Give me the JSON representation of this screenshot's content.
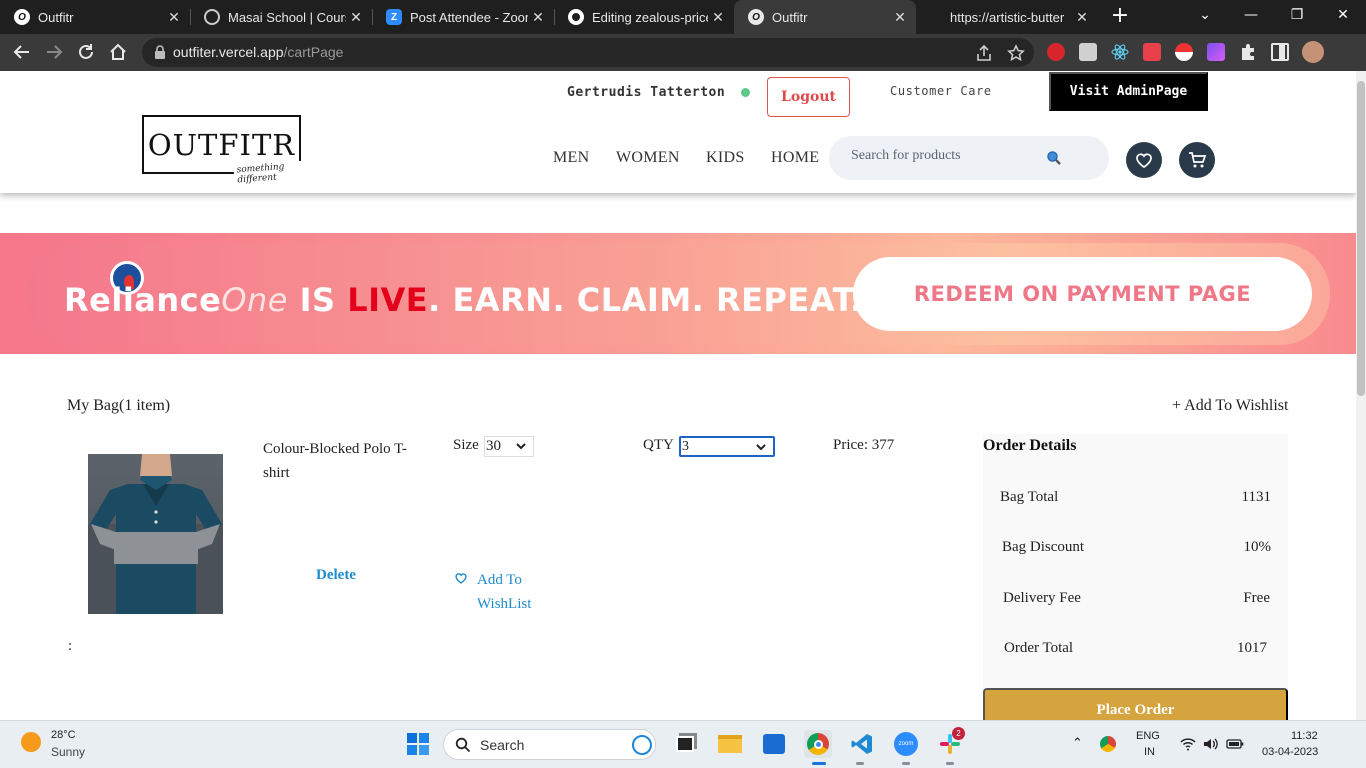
{
  "browser": {
    "tabs": [
      {
        "title": "Outfitr",
        "icon": "outfitr-icon"
      },
      {
        "title": "Masai School | Course",
        "icon": "globe-icon"
      },
      {
        "title": "Post Attendee - Zoom",
        "icon": "zoom-icon"
      },
      {
        "title": "Editing zealous-price-",
        "icon": "github-icon"
      },
      {
        "title": "Outfitr",
        "icon": "outfitr-icon"
      },
      {
        "title": "https://artistic-butter",
        "icon": "blank-icon"
      }
    ],
    "url_host": "outfiter.vercel.app",
    "url_path": "/cartPage"
  },
  "header": {
    "username": "Gertrudis Tatterton",
    "logout_label": "Logout",
    "customer_care_label": "Customer Care",
    "admin_label": "Visit AdminPage",
    "logo_text": "OUTFITR",
    "logo_tagline": "something different",
    "nav": [
      "MEN",
      "WOMEN",
      "KIDS",
      "HOME"
    ],
    "search_placeholder": "Search for products",
    "colors": {
      "accent": "#e04848",
      "icon_bg": "#2b3a4a",
      "online": "#5cc98a"
    }
  },
  "banner": {
    "brand_a": "Reliance",
    "brand_b": "One",
    "text_a": "IS",
    "text_live": "LIVE",
    "text_b": ". EARN. CLAIM. REPEAT.",
    "cta": "REDEEM ON PAYMENT PAGE"
  },
  "cart": {
    "bag_title": "My Bag(1 item)",
    "add_wishlist_top": "+ Add To Wishlist",
    "item": {
      "name": "Colour-Blocked Polo T-shirt",
      "size_label": "Size",
      "size_value": "30",
      "qty_label": "QTY",
      "qty_value": "3",
      "price_text": "Price: 377",
      "delete_label": "Delete",
      "wishlist_label": "Add To WishList"
    },
    "colon": ":"
  },
  "order": {
    "title": "Order Details",
    "rows": [
      {
        "label": "Bag Total",
        "value": "1131"
      },
      {
        "label": "Bag Discount",
        "value": "10%"
      },
      {
        "label": "Delivery Fee",
        "value": "Free"
      },
      {
        "label": "Order Total",
        "value": "1017"
      }
    ],
    "place_order_label": "Place Order",
    "button_color": "#d5a43e"
  },
  "taskbar": {
    "temp": "28°C",
    "weather": "Sunny",
    "search_label": "Search",
    "lang_a": "ENG",
    "lang_b": "IN",
    "time": "11:32",
    "date": "03-04-2023",
    "slack_badge": "2"
  }
}
